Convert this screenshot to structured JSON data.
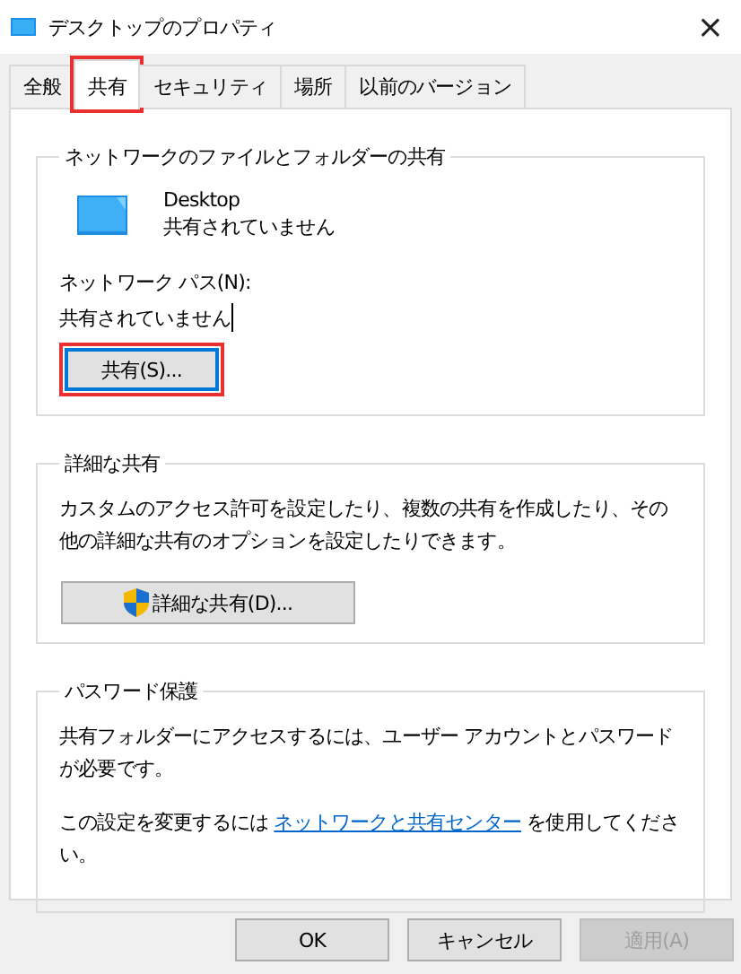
{
  "window": {
    "title": "デスクトップのプロパティ",
    "close": "×"
  },
  "tabs": [
    {
      "label": "全般",
      "selected": false,
      "highlighted": false
    },
    {
      "label": "共有",
      "selected": true,
      "highlighted": true
    },
    {
      "label": "セキュリティ",
      "selected": false,
      "highlighted": false
    },
    {
      "label": "場所",
      "selected": false,
      "highlighted": false
    },
    {
      "label": "以前のバージョン",
      "selected": false,
      "highlighted": false
    }
  ],
  "network_sharing": {
    "title": "ネットワークのファイルとフォルダーの共有",
    "folder_name": "Desktop",
    "folder_status": "共有されていません",
    "path_label": "ネットワーク パス(N):",
    "path_value": "共有されていません",
    "share_button": {
      "label": "共有(S)...",
      "highlighted": true,
      "focused": true
    }
  },
  "advanced_sharing": {
    "title": "詳細な共有",
    "description": "カスタムのアクセス許可を設定したり、複数の共有を作成したり、その他の詳細な共有のオプションを設定したりできます。",
    "button": "詳細な共有(D)..."
  },
  "password_protection": {
    "title": "パスワード保護",
    "description": "共有フォルダーにアクセスするには、ユーザー アカウントとパスワードが必要です。",
    "link_before": "この設定を変更するには",
    "link": "ネットワークと共有センター",
    "link_after": "を使用してください。"
  },
  "buttons": [
    {
      "label": "OK",
      "disabled": false
    },
    {
      "label": "キャンセル",
      "disabled": false
    },
    {
      "label": "適用(A)",
      "disabled": true
    }
  ]
}
